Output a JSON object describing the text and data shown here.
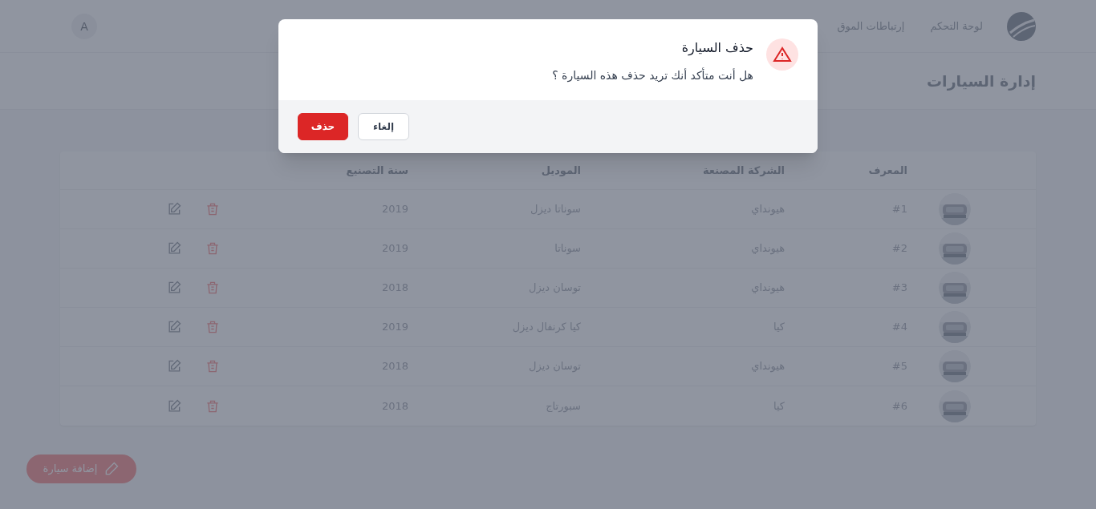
{
  "header": {
    "nav": [
      {
        "label": "لوحة التحكم"
      },
      {
        "label": "إرتباطات الموق"
      }
    ],
    "avatar": "A"
  },
  "page_title": "إدارة السيارات",
  "table": {
    "columns": [
      "المعرف",
      "الشركة المصنعة",
      "الموديل",
      "سنة التصنيع"
    ],
    "rows": [
      {
        "id": "#1",
        "maker": "هيونداي",
        "model": "سوناتا ديزل",
        "year": "2019"
      },
      {
        "id": "#2",
        "maker": "هيونداي",
        "model": "سوناتا",
        "year": "2019"
      },
      {
        "id": "#3",
        "maker": "هيونداي",
        "model": "توسان ديزل",
        "year": "2018"
      },
      {
        "id": "#4",
        "maker": "كيا",
        "model": "كيا كرنفال ديزل",
        "year": "2019"
      },
      {
        "id": "#5",
        "maker": "هيونداي",
        "model": "توسان ديزل",
        "year": "2018"
      },
      {
        "id": "#6",
        "maker": "كيا",
        "model": "سبورتاج",
        "year": "2018"
      }
    ]
  },
  "add_button": "إضافة سيارة",
  "dialog": {
    "title": "حذف السيارة",
    "message": "هل أنت متأكد أنك تريد حذف هذه السيارة ؟",
    "buttons": [
      {
        "kind": "secondary",
        "label": "إلغاء"
      },
      {
        "kind": "danger",
        "label": "حذف"
      }
    ]
  }
}
